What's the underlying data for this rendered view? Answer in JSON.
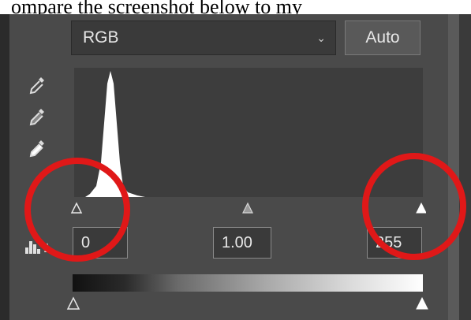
{
  "caption": "ompare the screenshot below to my",
  "levels": {
    "channel": "RGB",
    "auto_label": "Auto",
    "input_black": "0",
    "input_gamma": "1.00",
    "input_white": "255"
  },
  "icons": [
    "eyedropper-black-icon",
    "eyedropper-gray-icon",
    "eyedropper-white-icon",
    "histogram-icon",
    "chevron-down-icon"
  ],
  "colors": {
    "panel": "#4a4a4a",
    "histogram_bg": "#3d3d3d",
    "annotation": "#e01818"
  }
}
